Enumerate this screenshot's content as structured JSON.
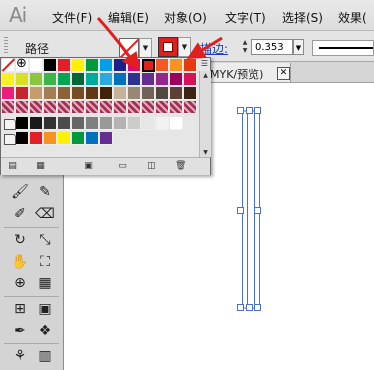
{
  "app": {
    "logo": "Ai"
  },
  "menubar": {
    "items": [
      {
        "label": "文件(F)"
      },
      {
        "label": "编辑(E)"
      },
      {
        "label": "对象(O)"
      },
      {
        "label": "文字(T)"
      },
      {
        "label": "选择(S)"
      },
      {
        "label": "效果("
      }
    ]
  },
  "controlbar": {
    "object_type": "路径",
    "fill": {
      "icon": "none-swatch-icon",
      "color": "#ffffff"
    },
    "stroke": {
      "color": "#e0201f"
    },
    "stroke_label": "描边:",
    "stroke_weight": "0.353",
    "stroke_line_icon": "line-style-preview"
  },
  "document": {
    "tab_title": "MYK/预览)",
    "close_icon": "close-icon"
  },
  "swatches": {
    "rows": [
      [
        "none",
        "reg",
        "#ffffff",
        "#000000",
        "#e21f26",
        "#fff100",
        "#009a3d",
        "#00a0e9",
        "#1d2088",
        "#e4007f",
        "#e0201f",
        "#f15a22",
        "#f7931e",
        "#e8380d"
      ],
      [
        "#fcee21",
        "#d9e021",
        "#8cc63f",
        "#39b54a",
        "#00a651",
        "#006837",
        "#00a99d",
        "#29abe2",
        "#0071bc",
        "#2e3192",
        "#662d91",
        "#93278f",
        "#9e005d",
        "#d4145a"
      ],
      [
        "#ed1e79",
        "#c1272d",
        "#c69c6d",
        "#a67c52",
        "#8c6239",
        "#754c24",
        "#603813",
        "#42210b",
        "#c7b299",
        "#998675",
        "#736357",
        "#534741",
        "#5c4033",
        "#3b2314"
      ],
      [
        "pattern",
        "pattern",
        "pattern",
        "pattern",
        "pattern",
        "pattern",
        "pattern",
        "pattern",
        "pattern",
        "pattern",
        "pattern",
        "pattern",
        "pattern",
        "pattern"
      ]
    ],
    "gray_group": [
      "#000000",
      "#1a1a1a",
      "#333333",
      "#4d4d4d",
      "#666666",
      "#808080",
      "#999999",
      "#b3b3b3",
      "#cccccc",
      "#e6e6e6",
      "#f2f2f2",
      "#ffffff"
    ],
    "color_group": [
      "#000000",
      "#e21f26",
      "#f7931e",
      "#fff100",
      "#009a3d",
      "#0071bc",
      "#662d91"
    ],
    "selected_color": "#e0201f",
    "bottom_icons": [
      "swatch-libraries-icon",
      "show-swatch-kinds-icon",
      "swatch-options-icon",
      "new-color-group-icon",
      "new-swatch-icon",
      "delete-swatch-icon"
    ]
  },
  "tools": {
    "icons": [
      "paintbrush-icon",
      "pencil-icon",
      "blob-brush-icon",
      "eraser-icon",
      "rotate-icon",
      "scale-icon",
      "warp-icon",
      "free-transform-icon",
      "symbol-sprayer-icon",
      "graph-icon",
      "mesh-icon",
      "gradient-icon",
      "eyedropper-icon",
      "blend-icon",
      "symbol-icon",
      "column-graph-icon"
    ]
  },
  "accent": {
    "annotation": "#e0201f",
    "link_blue": "#1a3fbf"
  }
}
